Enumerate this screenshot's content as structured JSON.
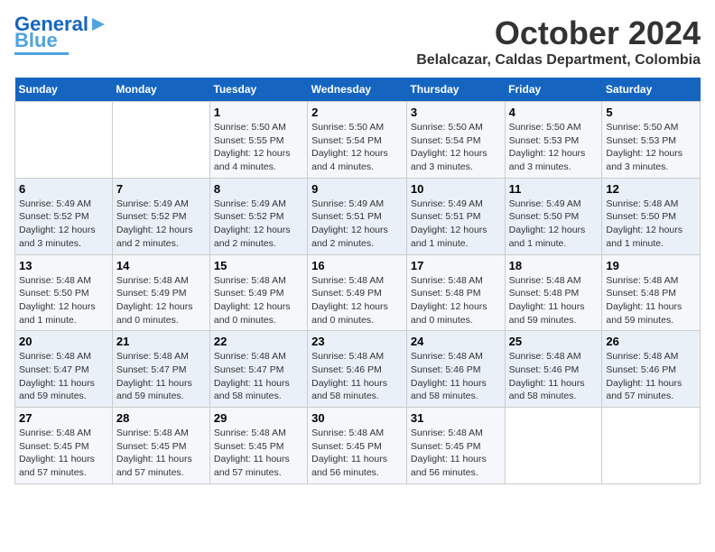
{
  "logo": {
    "line1": "General",
    "line2": "Blue"
  },
  "title": "October 2024",
  "subtitle": "Belalcazar, Caldas Department, Colombia",
  "days_header": [
    "Sunday",
    "Monday",
    "Tuesday",
    "Wednesday",
    "Thursday",
    "Friday",
    "Saturday"
  ],
  "weeks": [
    [
      {
        "day": "",
        "info": ""
      },
      {
        "day": "",
        "info": ""
      },
      {
        "day": "1",
        "info": "Sunrise: 5:50 AM\nSunset: 5:55 PM\nDaylight: 12 hours\nand 4 minutes."
      },
      {
        "day": "2",
        "info": "Sunrise: 5:50 AM\nSunset: 5:54 PM\nDaylight: 12 hours\nand 4 minutes."
      },
      {
        "day": "3",
        "info": "Sunrise: 5:50 AM\nSunset: 5:54 PM\nDaylight: 12 hours\nand 3 minutes."
      },
      {
        "day": "4",
        "info": "Sunrise: 5:50 AM\nSunset: 5:53 PM\nDaylight: 12 hours\nand 3 minutes."
      },
      {
        "day": "5",
        "info": "Sunrise: 5:50 AM\nSunset: 5:53 PM\nDaylight: 12 hours\nand 3 minutes."
      }
    ],
    [
      {
        "day": "6",
        "info": "Sunrise: 5:49 AM\nSunset: 5:52 PM\nDaylight: 12 hours\nand 3 minutes."
      },
      {
        "day": "7",
        "info": "Sunrise: 5:49 AM\nSunset: 5:52 PM\nDaylight: 12 hours\nand 2 minutes."
      },
      {
        "day": "8",
        "info": "Sunrise: 5:49 AM\nSunset: 5:52 PM\nDaylight: 12 hours\nand 2 minutes."
      },
      {
        "day": "9",
        "info": "Sunrise: 5:49 AM\nSunset: 5:51 PM\nDaylight: 12 hours\nand 2 minutes."
      },
      {
        "day": "10",
        "info": "Sunrise: 5:49 AM\nSunset: 5:51 PM\nDaylight: 12 hours\nand 1 minute."
      },
      {
        "day": "11",
        "info": "Sunrise: 5:49 AM\nSunset: 5:50 PM\nDaylight: 12 hours\nand 1 minute."
      },
      {
        "day": "12",
        "info": "Sunrise: 5:48 AM\nSunset: 5:50 PM\nDaylight: 12 hours\nand 1 minute."
      }
    ],
    [
      {
        "day": "13",
        "info": "Sunrise: 5:48 AM\nSunset: 5:50 PM\nDaylight: 12 hours\nand 1 minute."
      },
      {
        "day": "14",
        "info": "Sunrise: 5:48 AM\nSunset: 5:49 PM\nDaylight: 12 hours\nand 0 minutes."
      },
      {
        "day": "15",
        "info": "Sunrise: 5:48 AM\nSunset: 5:49 PM\nDaylight: 12 hours\nand 0 minutes."
      },
      {
        "day": "16",
        "info": "Sunrise: 5:48 AM\nSunset: 5:49 PM\nDaylight: 12 hours\nand 0 minutes."
      },
      {
        "day": "17",
        "info": "Sunrise: 5:48 AM\nSunset: 5:48 PM\nDaylight: 12 hours\nand 0 minutes."
      },
      {
        "day": "18",
        "info": "Sunrise: 5:48 AM\nSunset: 5:48 PM\nDaylight: 11 hours\nand 59 minutes."
      },
      {
        "day": "19",
        "info": "Sunrise: 5:48 AM\nSunset: 5:48 PM\nDaylight: 11 hours\nand 59 minutes."
      }
    ],
    [
      {
        "day": "20",
        "info": "Sunrise: 5:48 AM\nSunset: 5:47 PM\nDaylight: 11 hours\nand 59 minutes."
      },
      {
        "day": "21",
        "info": "Sunrise: 5:48 AM\nSunset: 5:47 PM\nDaylight: 11 hours\nand 59 minutes."
      },
      {
        "day": "22",
        "info": "Sunrise: 5:48 AM\nSunset: 5:47 PM\nDaylight: 11 hours\nand 58 minutes."
      },
      {
        "day": "23",
        "info": "Sunrise: 5:48 AM\nSunset: 5:46 PM\nDaylight: 11 hours\nand 58 minutes."
      },
      {
        "day": "24",
        "info": "Sunrise: 5:48 AM\nSunset: 5:46 PM\nDaylight: 11 hours\nand 58 minutes."
      },
      {
        "day": "25",
        "info": "Sunrise: 5:48 AM\nSunset: 5:46 PM\nDaylight: 11 hours\nand 58 minutes."
      },
      {
        "day": "26",
        "info": "Sunrise: 5:48 AM\nSunset: 5:46 PM\nDaylight: 11 hours\nand 57 minutes."
      }
    ],
    [
      {
        "day": "27",
        "info": "Sunrise: 5:48 AM\nSunset: 5:45 PM\nDaylight: 11 hours\nand 57 minutes."
      },
      {
        "day": "28",
        "info": "Sunrise: 5:48 AM\nSunset: 5:45 PM\nDaylight: 11 hours\nand 57 minutes."
      },
      {
        "day": "29",
        "info": "Sunrise: 5:48 AM\nSunset: 5:45 PM\nDaylight: 11 hours\nand 57 minutes."
      },
      {
        "day": "30",
        "info": "Sunrise: 5:48 AM\nSunset: 5:45 PM\nDaylight: 11 hours\nand 56 minutes."
      },
      {
        "day": "31",
        "info": "Sunrise: 5:48 AM\nSunset: 5:45 PM\nDaylight: 11 hours\nand 56 minutes."
      },
      {
        "day": "",
        "info": ""
      },
      {
        "day": "",
        "info": ""
      }
    ]
  ]
}
